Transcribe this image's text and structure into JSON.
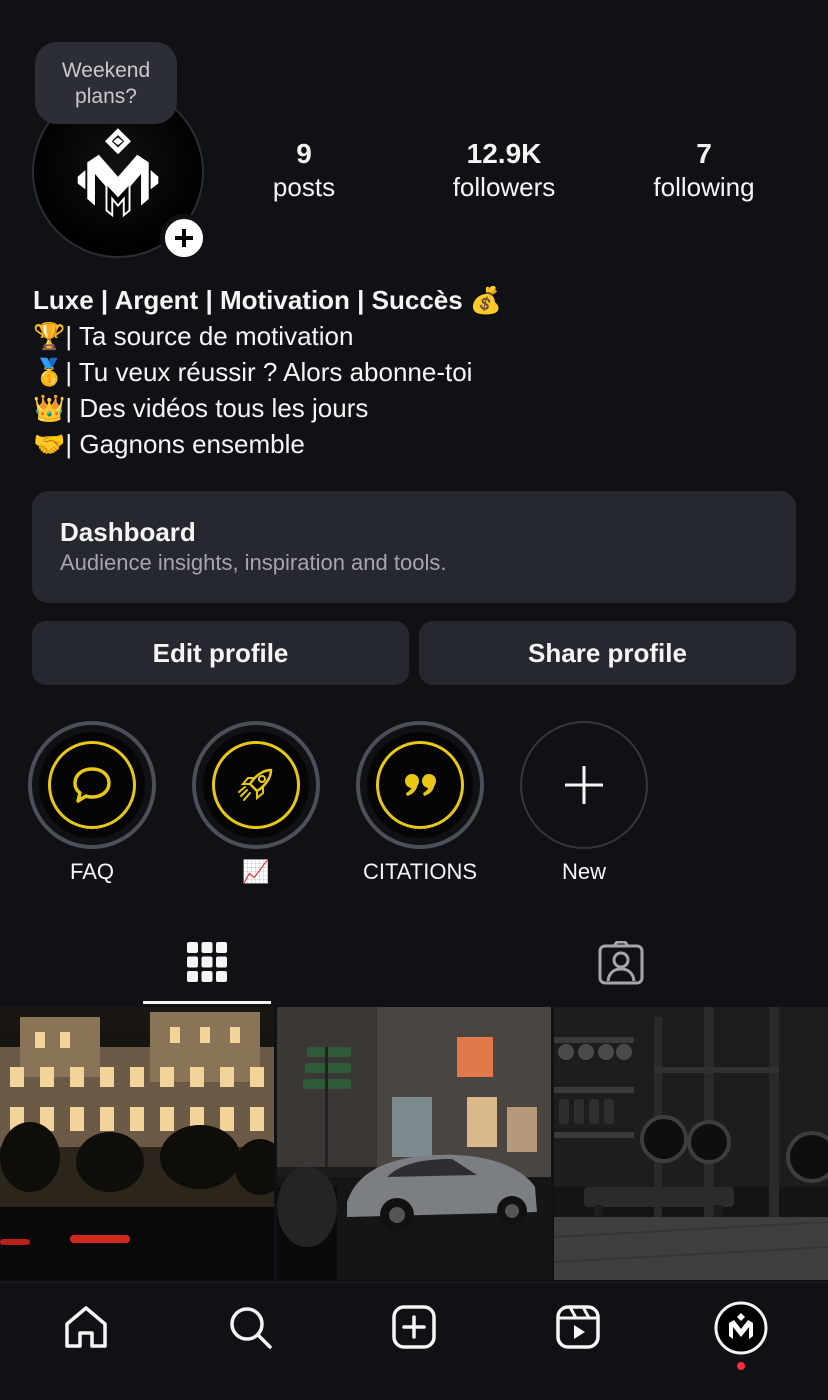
{
  "note": {
    "text_line1": "Weekend",
    "text_line2": "plans?"
  },
  "stats": {
    "posts": {
      "value": "9",
      "label": "posts"
    },
    "followers": {
      "value": "12.9K",
      "label": "followers"
    },
    "following": {
      "value": "7",
      "label": "following"
    }
  },
  "bio": {
    "name": "Luxe | Argent | Motivation | Succès 💰",
    "lines": [
      "🏆| Ta source de motivation",
      "🥇| Tu veux réussir ? Alors abonne-toi",
      "👑| Des vidéos tous les jours",
      "🤝| Gagnons ensemble"
    ]
  },
  "dashboard": {
    "title": "Dashboard",
    "subtitle": "Audience insights, inspiration and tools."
  },
  "buttons": {
    "edit": "Edit profile",
    "share": "Share profile"
  },
  "highlights": [
    {
      "label": "FAQ",
      "icon": "chat-bubble-icon"
    },
    {
      "label": "📈",
      "icon": "rocket-icon"
    },
    {
      "label": "CITATIONS",
      "icon": "quote-icon"
    },
    {
      "label": "New",
      "icon": "plus-icon"
    }
  ],
  "tabs": {
    "grid": "grid-icon",
    "tagged": "tagged-person-icon"
  },
  "posts": [
    {
      "description": "casino-building-night"
    },
    {
      "description": "rolls-royce-street-night"
    },
    {
      "description": "dark-home-gym"
    }
  ],
  "nav": [
    "home-icon",
    "search-icon",
    "create-icon",
    "reels-icon",
    "profile-avatar"
  ],
  "colors": {
    "background": "#0f1115",
    "card": "#25282e",
    "highlight_gold": "#e6c815",
    "notification_red": "#ff2a3a"
  }
}
